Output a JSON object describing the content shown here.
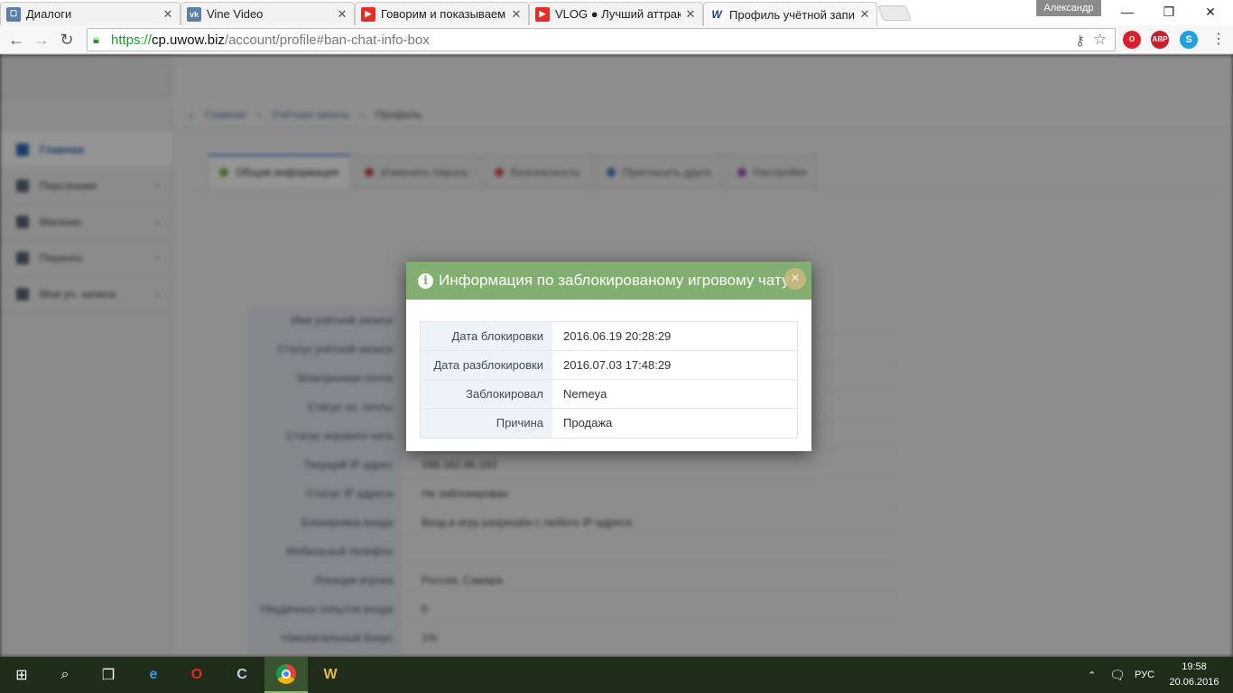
{
  "browser": {
    "tabs": [
      {
        "title": "Диалоги",
        "favicon": "vk-dialogs-icon",
        "color": "#5b7fa6",
        "glyph": "☐"
      },
      {
        "title": "Vine Video",
        "favicon": "vk-icon",
        "color": "#5b7fa6",
        "glyph": "vk"
      },
      {
        "title": "Говорим и показываем -",
        "favicon": "youtube-icon",
        "color": "#e52d27",
        "glyph": "▶"
      },
      {
        "title": "VLOG ● Лучший аттракц",
        "favicon": "youtube-icon",
        "color": "#e52d27",
        "glyph": "▶"
      },
      {
        "title": "Профиль учётной запис",
        "favicon": "uwow-icon",
        "color": "#1d3d7a",
        "glyph": "W"
      }
    ],
    "profile_name": "Александр",
    "window_controls": {
      "minimize": "—",
      "maximize": "❐",
      "close": "✕"
    },
    "address": {
      "scheme": "https://",
      "host": "cp.uwow.biz",
      "rest": "/account/profile#ban-chat-info-box"
    }
  },
  "page": {
    "sidebar": [
      "Главная",
      "Персонажи",
      "Магазин",
      "Перенос",
      "Мои уч. записи"
    ],
    "breadcrumb": [
      "Главная",
      "Учётная запись",
      "Профиль"
    ],
    "tabs": [
      {
        "label": "Общая информация",
        "color": "#7cb342"
      },
      {
        "label": "Изменить пароль",
        "color": "#c0504d"
      },
      {
        "label": "Безопасность",
        "color": "#d9534f"
      },
      {
        "label": "Пригласить друга",
        "color": "#4a7ec8"
      },
      {
        "label": "Настройки",
        "color": "#9b59b6"
      }
    ],
    "profile_rows": [
      {
        "label": "Имя учётной записи",
        "value": ""
      },
      {
        "label": "Статус учётной записи",
        "value": ""
      },
      {
        "label": "Электронная почта",
        "value": ""
      },
      {
        "label": "Статус эл. почты",
        "value": ""
      },
      {
        "label": "Статус игрового чата",
        "value": ""
      },
      {
        "label": "Текущий IP адрес",
        "value": "188.162.86.163"
      },
      {
        "label": "Статус IP адреса",
        "value": "Не заблокирован"
      },
      {
        "label": "Блокировка входа",
        "value": "Вход в игру разрешён с любого IP адреса"
      },
      {
        "label": "Мобильный телефон",
        "value": ""
      },
      {
        "label": "Локация игрока",
        "value": "Россия, Самара"
      },
      {
        "label": "Неудачных попыток входа",
        "value": "0"
      },
      {
        "label": "Накопительный бонус",
        "value": "1%"
      }
    ]
  },
  "modal": {
    "title": "Информация по заблокированому игровому чату",
    "close_label": "×",
    "rows": [
      {
        "label": "Дата блокировки",
        "value": "2016.06.19 20:28:29"
      },
      {
        "label": "Дата разблокировки",
        "value": "2016.07.03 17:48:29"
      },
      {
        "label": "Заблокировал",
        "value": "Nemeya"
      },
      {
        "label": "Причина",
        "value": "Продажа"
      }
    ]
  },
  "taskbar": {
    "language": "РУС",
    "time": "19:58",
    "date": "20.06.2016"
  }
}
